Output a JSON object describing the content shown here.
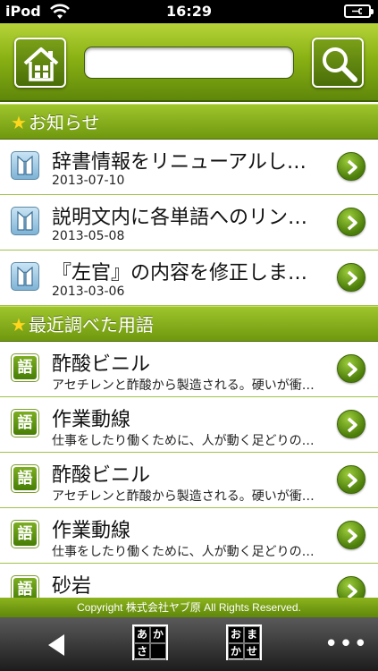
{
  "status_bar": {
    "carrier": "iPod",
    "time": "16:29"
  },
  "header": {
    "search_placeholder": ""
  },
  "sections": {
    "news": {
      "heading": "お知らせ"
    },
    "recent": {
      "heading": "最近調べた用語"
    }
  },
  "news_items": [
    {
      "title": "辞書情報をリニューアルしました",
      "date": "2013-07-10"
    },
    {
      "title": "説明文内に各単語へのリンクを追加",
      "date": "2013-05-08"
    },
    {
      "title": "『左官』の内容を修正しました",
      "date": "2013-03-06"
    }
  ],
  "recent_terms": [
    {
      "term": "酢酸ビニル",
      "desc": "アセチレンと酢酸から製造される。硬いが衝撃に弱い"
    },
    {
      "term": "作業動線",
      "desc": "仕事をしたり働くために、人が動く足どりの軌跡"
    },
    {
      "term": "酢酸ビニル",
      "desc": "アセチレンと酢酸から製造される。硬いが衝撃に弱い"
    },
    {
      "term": "作業動線",
      "desc": "仕事をしたり働くために、人が動く足どりの軌跡"
    },
    {
      "term": "砂岩",
      "desc": ""
    }
  ],
  "term_icon_char": "語",
  "footer": {
    "copyright": "Copyright 株式会社ヤブ原 All Rights Reserved."
  },
  "toolbar": {
    "akasa_keys": [
      "あ",
      "か",
      "さ",
      ""
    ],
    "omakase_keys": [
      "お",
      "ま",
      "か",
      "せ"
    ],
    "more_label": "•••"
  },
  "colors": {
    "accent": "#7aa817",
    "star": "#ffd71c"
  }
}
